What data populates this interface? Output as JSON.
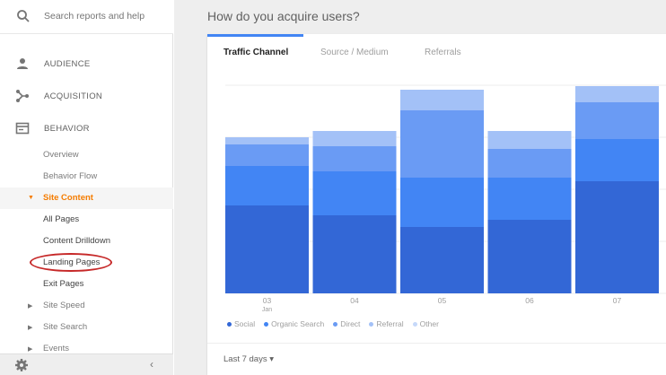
{
  "search": {
    "placeholder": "Search reports and help"
  },
  "sections": [
    {
      "label": "AUDIENCE",
      "icon": "person-icon"
    },
    {
      "label": "ACQUISITION",
      "icon": "acquisition-icon"
    },
    {
      "label": "BEHAVIOR",
      "icon": "behavior-icon"
    }
  ],
  "behavior_items": [
    {
      "label": "Overview"
    },
    {
      "label": "Behavior Flow"
    }
  ],
  "site_content": {
    "label": "Site Content"
  },
  "site_content_items": [
    {
      "label": "All Pages"
    },
    {
      "label": "Content Drilldown"
    },
    {
      "label": "Landing Pages"
    },
    {
      "label": "Exit Pages"
    }
  ],
  "collapsed_items": [
    {
      "label": "Site Speed"
    },
    {
      "label": "Site Search"
    },
    {
      "label": "Events"
    }
  ],
  "main": {
    "title": "How do you acquire users?",
    "tabs": [
      {
        "label": "Traffic Channel",
        "active": true
      },
      {
        "label": "Source / Medium",
        "active": false
      },
      {
        "label": "Referrals",
        "active": false
      }
    ],
    "date_range": "Last 7 days"
  },
  "colors": {
    "social": "#3367d6",
    "organic": "#4285f4",
    "direct": "#6a9bf4",
    "referral": "#a3c1f7",
    "other": "#c6d9fa",
    "active": "#f57c00",
    "accent": "#4285f4"
  },
  "chart_data": {
    "type": "bar",
    "stacked": true,
    "categories": [
      "03",
      "04",
      "05",
      "06",
      "07"
    ],
    "category_sublabels": [
      "Jan",
      "",
      "",
      "",
      ""
    ],
    "series": [
      {
        "name": "Social",
        "values": [
          98,
          87,
          74,
          82,
          125
        ]
      },
      {
        "name": "Organic Search",
        "values": [
          44,
          49,
          55,
          47,
          47
        ]
      },
      {
        "name": "Direct",
        "values": [
          24,
          28,
          75,
          32,
          41
        ]
      },
      {
        "name": "Referral",
        "values": [
          8,
          17,
          23,
          20,
          18
        ]
      },
      {
        "name": "Other",
        "values": [
          0,
          0,
          0,
          0,
          0
        ]
      }
    ],
    "ylim": [
      0,
      232
    ],
    "grid": true,
    "legend": "bottom-left"
  }
}
